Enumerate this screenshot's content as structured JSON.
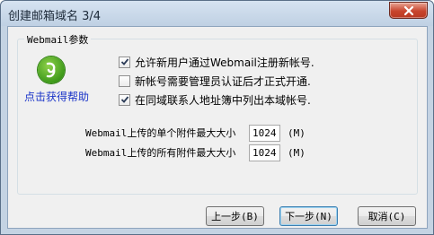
{
  "window": {
    "title": "创建邮箱域名 3/4"
  },
  "group": {
    "label": "Webmail参数"
  },
  "help": {
    "link_text": "点击获得帮助"
  },
  "options": [
    {
      "label": "允许新用户通过Webmail注册新帐号.",
      "checked": true
    },
    {
      "label": "新帐号需要管理员认证后才正式开通.",
      "checked": false
    },
    {
      "label": "在同域联系人地址簿中列出本域帐号.",
      "checked": true
    }
  ],
  "fields": [
    {
      "label": "Webmail上传的单个附件最大大小",
      "value": "1024",
      "unit": "(M)"
    },
    {
      "label": "Webmail上传的所有附件最大大小",
      "value": "1024",
      "unit": "(M)"
    }
  ],
  "buttons": {
    "prev": "上一步(B)",
    "next": "下一步(N)",
    "cancel": "取消(C)"
  },
  "colors": {
    "link": "#1a34c8",
    "close": "#c8452d",
    "logo": "#3e9a1a"
  }
}
